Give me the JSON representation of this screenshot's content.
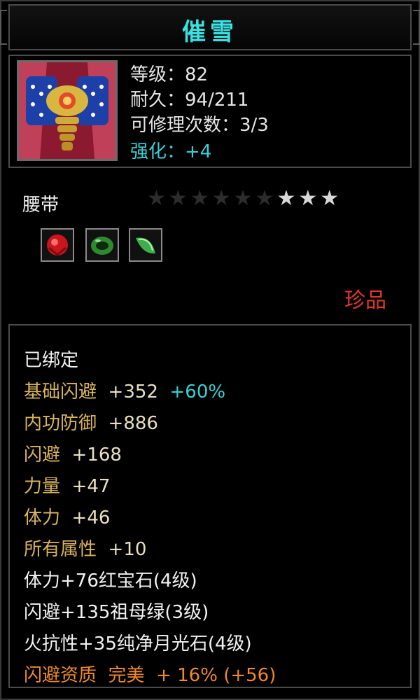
{
  "title": "催雪",
  "item": {
    "level": "等级：82",
    "durability": "耐久：94/211",
    "repairs": "可修理次数：3/3",
    "enhance": "强化：+4",
    "type": "腰带",
    "stars_total": 9,
    "stars_lit": 3,
    "rarity": "珍品",
    "gems": [
      "ruby-icon",
      "emerald-icon",
      "moonstone-icon"
    ]
  },
  "attrs": {
    "bound": "已绑定",
    "base_dodge_label": "基础闪避",
    "base_dodge_val": "+352",
    "base_dodge_pct": "+60%",
    "inner_def_label": "内功防御",
    "inner_def_val": "+886",
    "dodge_label": "闪避",
    "dodge_val": "+168",
    "strength_label": "力量",
    "strength_val": "+47",
    "stamina_label": "体力",
    "stamina_val": "+46",
    "all_label": "所有属性",
    "all_val": "+10",
    "gem1": "体力+76红宝石(4级)",
    "gem2": "闪避+135祖母绿(3级)",
    "gem3": "火抗性+35纯净月光石(4级)",
    "quality_label": "闪避资质",
    "quality_grade": "完美",
    "quality_val": "+ 16% (+56)"
  }
}
